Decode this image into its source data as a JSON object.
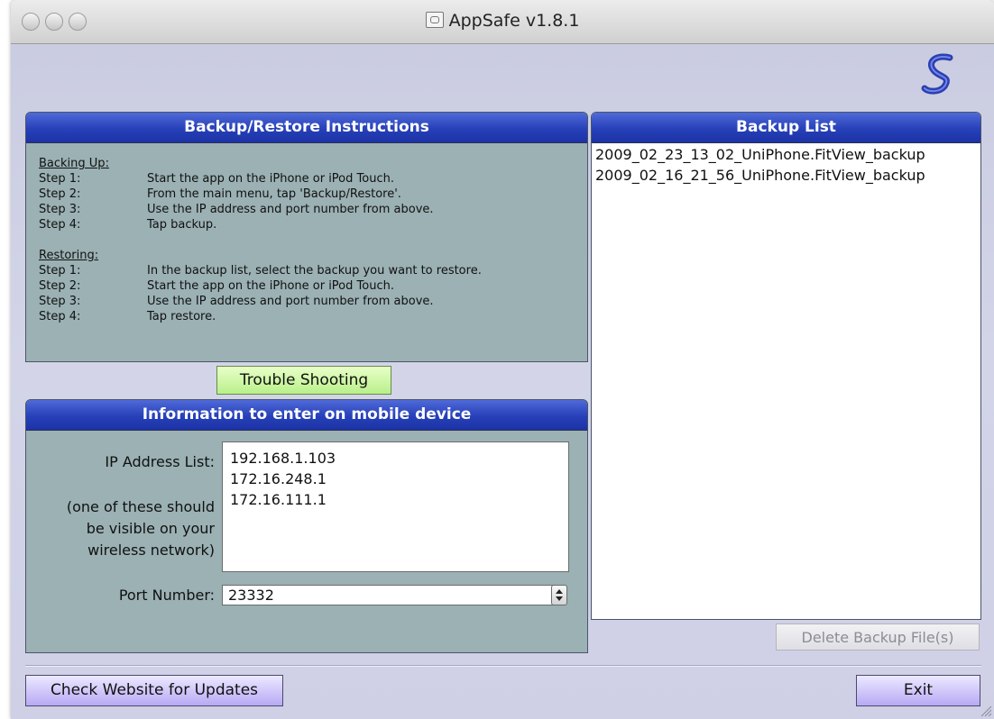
{
  "window": {
    "title": "AppSafe v1.8.1"
  },
  "instructions": {
    "header": "Backup/Restore Instructions",
    "backing_up": {
      "heading": "Backing Up:",
      "steps": [
        {
          "label": "Step 1:",
          "text": "Start the app on the iPhone or iPod Touch."
        },
        {
          "label": "Step 2:",
          "text": "From the main menu, tap 'Backup/Restore'."
        },
        {
          "label": "Step 3:",
          "text": "Use the IP address and port number from above."
        },
        {
          "label": "Step 4:",
          "text": "Tap backup."
        }
      ]
    },
    "restoring": {
      "heading": "Restoring:",
      "steps": [
        {
          "label": "Step 1:",
          "text": "In the backup list, select the backup you want to restore."
        },
        {
          "label": "Step 2:",
          "text": "Start the app on the iPhone or iPod Touch."
        },
        {
          "label": "Step 3:",
          "text": "Use the IP address and port number from above."
        },
        {
          "label": "Step 4:",
          "text": "Tap restore."
        }
      ]
    }
  },
  "trouble_button": "Trouble Shooting",
  "info": {
    "header": "Information to enter on mobile device",
    "ip_label": "IP Address List:",
    "ip_note": [
      "(one of these should",
      "be visible on your",
      "wireless network)"
    ],
    "ips": [
      "192.168.1.103",
      "172.16.248.1",
      "172.16.111.1"
    ],
    "port_label": "Port Number:",
    "port_value": "23332"
  },
  "backup_list": {
    "header": "Backup List",
    "items": [
      "2009_02_23_13_02_UniPhone.FitView_backup",
      "2009_02_16_21_56_UniPhone.FitView_backup"
    ],
    "delete_label": "Delete Backup File(s)"
  },
  "footer": {
    "check_label": "Check Website for Updates",
    "exit_label": "Exit"
  },
  "icons": {
    "close": "close-icon",
    "minimize": "minimize-icon",
    "zoom": "zoom-icon",
    "logo": "appsafe-logo-icon",
    "stepper": "stepper-arrows-icon",
    "resize": "resize-grip-icon"
  }
}
